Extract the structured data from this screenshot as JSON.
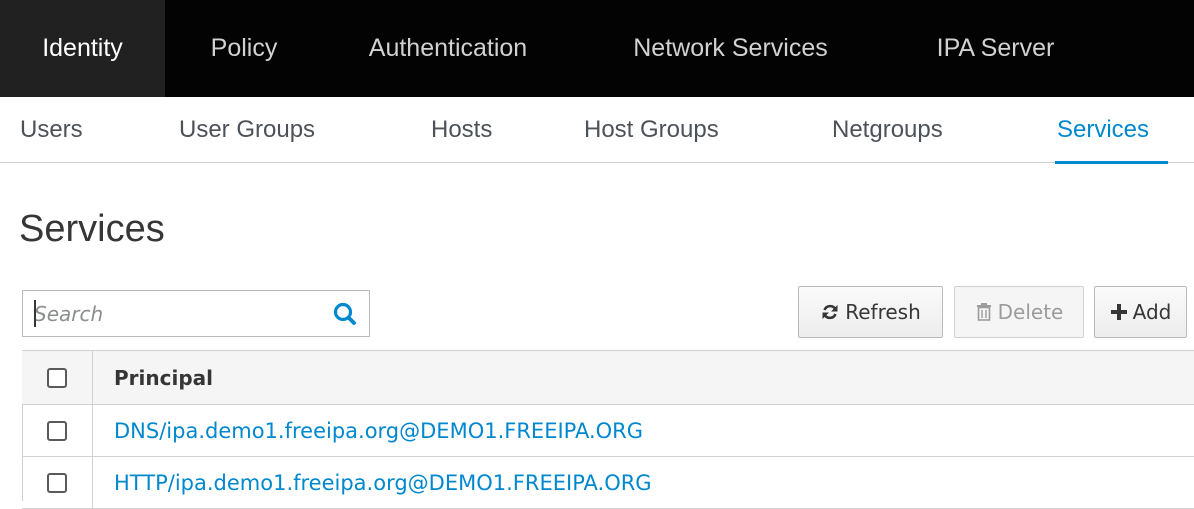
{
  "topnav": {
    "items": [
      {
        "label": "Identity"
      },
      {
        "label": "Policy"
      },
      {
        "label": "Authentication"
      },
      {
        "label": "Network Services"
      },
      {
        "label": "IPA Server"
      }
    ],
    "active": "Identity"
  },
  "subnav": {
    "items": [
      {
        "label": "Users"
      },
      {
        "label": "User Groups"
      },
      {
        "label": "Hosts"
      },
      {
        "label": "Host Groups"
      },
      {
        "label": "Netgroups"
      },
      {
        "label": "Services"
      }
    ],
    "active": "Services"
  },
  "page": {
    "title": "Services"
  },
  "search": {
    "value": "",
    "placeholder": "Search",
    "icon": "search-icon"
  },
  "toolbar": {
    "refresh_label": "Refresh",
    "refresh_icon": "refresh-icon",
    "delete_label": "Delete",
    "delete_icon": "trash-icon",
    "add_label": "Add",
    "add_icon": "plus-icon"
  },
  "table": {
    "columns": [
      "Principal"
    ],
    "rows": [
      {
        "principal": "DNS/ipa.demo1.freeipa.org@DEMO1.FREEIPA.ORG"
      },
      {
        "principal": "HTTP/ipa.demo1.freeipa.org@DEMO1.FREEIPA.ORG"
      }
    ]
  },
  "colors": {
    "topnav_bg": "#030303",
    "topnav_active_bg": "#212121",
    "accent": "#0088ce"
  }
}
